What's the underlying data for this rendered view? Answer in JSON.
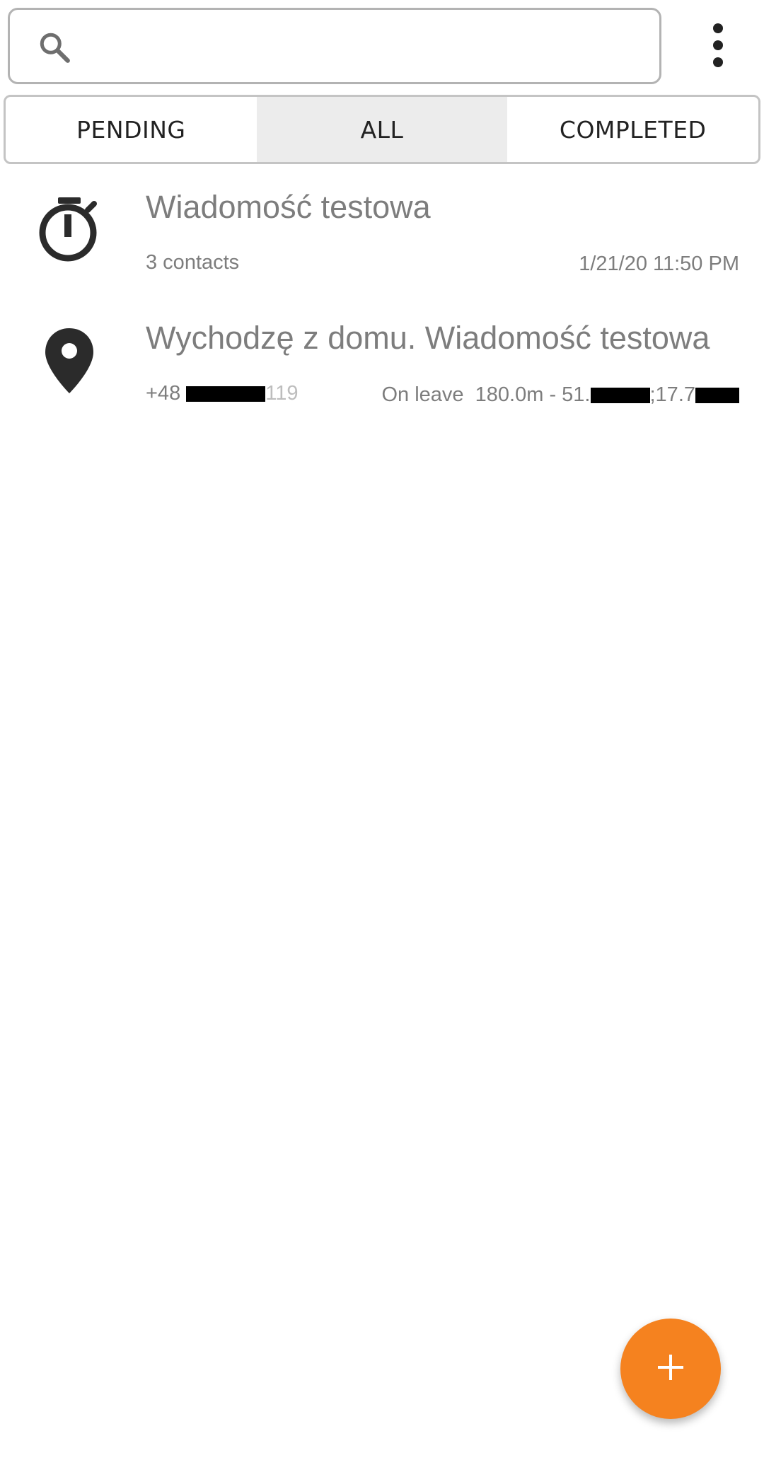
{
  "search": {
    "value": "",
    "placeholder": ""
  },
  "icons": {
    "search": "search-icon",
    "overflow": "more-vert-icon",
    "item1": "timer-icon",
    "item2": "location-pin-icon",
    "fab": "add-icon"
  },
  "tabs": [
    {
      "label": "PENDING",
      "active": false
    },
    {
      "label": "ALL",
      "active": true
    },
    {
      "label": "COMPLETED",
      "active": false
    }
  ],
  "items": [
    {
      "title": "Wiadomość testowa",
      "subtitle": "3 contacts",
      "right": "1/21/20 11:50 PM"
    },
    {
      "title": "Wychodzę z domu. Wiadomość testowa",
      "phone_prefix": "+48",
      "phone_suffix": "119",
      "status": "On leave",
      "distance": "180.0m - 51.",
      "coord_sep": ";17.7"
    }
  ],
  "colors": {
    "accent": "#f5821f",
    "text_secondary": "#7d7d7d",
    "tab_active_bg": "#ececec",
    "icon_dark": "#2b2b2b"
  }
}
